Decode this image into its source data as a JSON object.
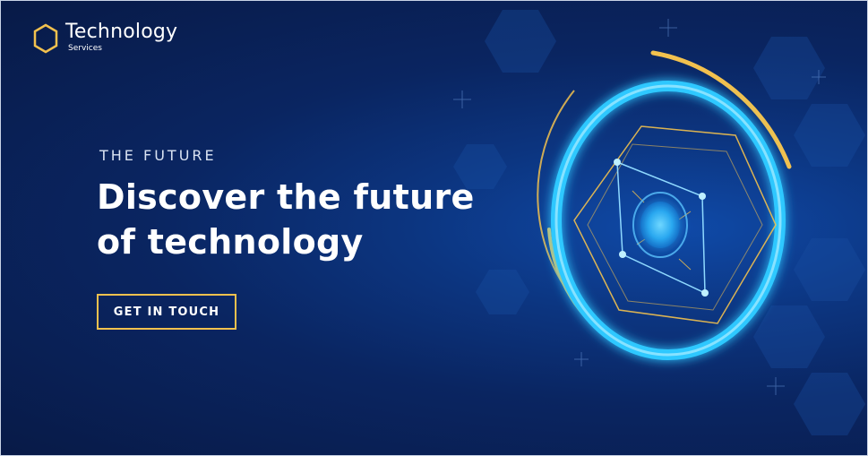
{
  "brand": {
    "name": "Technology",
    "subtitle": "Services",
    "icon": "hexagon-icon"
  },
  "hero": {
    "eyebrow": "THE FUTURE",
    "headline": "Discover the future of technology",
    "cta_label": "GET IN TOUCH"
  },
  "colors": {
    "accent": "#f2c14e",
    "background": "#0a2561",
    "glow": "#2ec8ff"
  }
}
